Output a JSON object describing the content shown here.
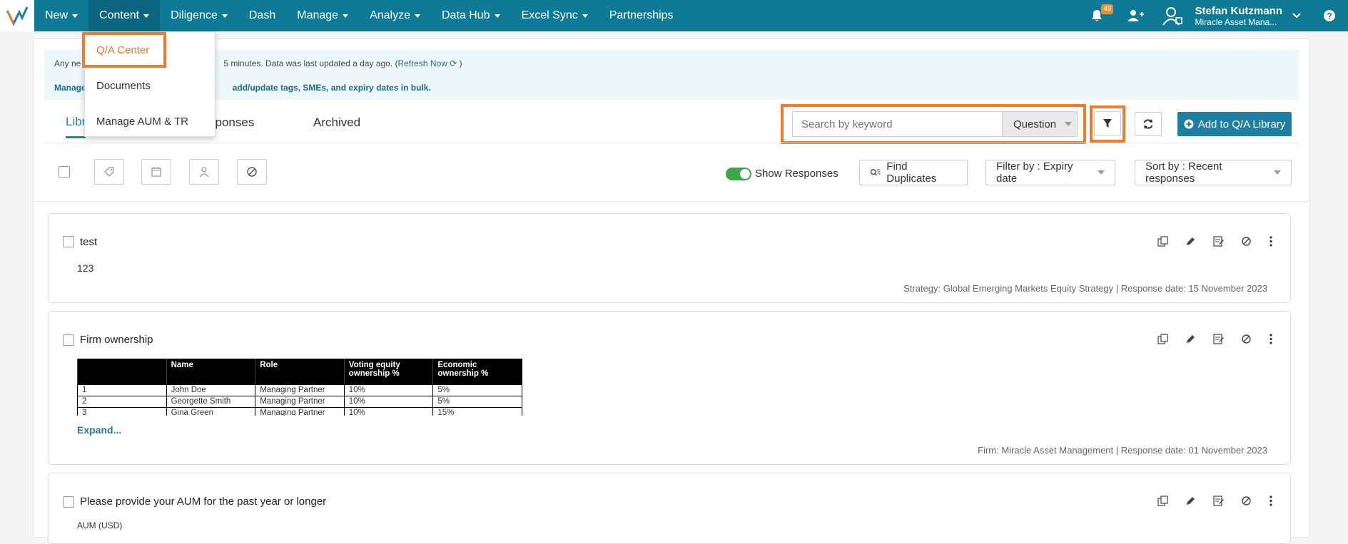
{
  "nav": {
    "items": [
      {
        "label": "New",
        "caret": true
      },
      {
        "label": "Content",
        "caret": true
      },
      {
        "label": "Diligence",
        "caret": true
      },
      {
        "label": "Dash",
        "caret": false
      },
      {
        "label": "Manage",
        "caret": true
      },
      {
        "label": "Analyze",
        "caret": true
      },
      {
        "label": "Data Hub",
        "caret": true
      },
      {
        "label": "Excel Sync",
        "caret": true
      },
      {
        "label": "Partnerships",
        "caret": false
      }
    ],
    "notification_count": "49",
    "user_name": "Stefan Kutzmann",
    "user_org": "Miracle Asset Mana..."
  },
  "content_menu": {
    "items": [
      "Q/A Center",
      "Documents",
      "Manage AUM & TR"
    ]
  },
  "info": {
    "line1_prefix": "Any ne",
    "line1_rest": "5 minutes. Data was last updated a day ago. (",
    "refresh": "Refresh Now",
    "line1_end": " )",
    "line2_prefix": "Manage",
    "line2_rest": "add/update tags, SMEs, and expiry dates in bulk."
  },
  "tabs": {
    "library": "Libr",
    "responses": "sponses",
    "archived": "Archived"
  },
  "search": {
    "placeholder": "Search by keyword",
    "scope": "Question"
  },
  "toolbar": {
    "add_label": "Add to Q/A Library",
    "show_responses": "Show Responses",
    "find_duplicates": "Find Duplicates",
    "filter_by": "Filter by : Expiry date",
    "sort_by": "Sort by : Recent responses"
  },
  "cards": [
    {
      "title": "test",
      "body": "123",
      "meta": "Strategy: Global Emerging Markets Equity Strategy | Response date: 15 November 2023"
    },
    {
      "title": "Firm ownership",
      "table": {
        "headers": [
          "",
          "Name",
          "Role",
          "Voting equity ownership %",
          "Economic ownership %"
        ],
        "rows": [
          [
            "1",
            "John Doe",
            "Managing Partner",
            "10%",
            "5%"
          ],
          [
            "2",
            "Georgette Smith",
            "Managing Partner",
            "10%",
            "5%"
          ],
          [
            "3",
            "Gina Green",
            "Managing Partner",
            "10%",
            "15%"
          ]
        ]
      },
      "expand": "Expand...",
      "meta": "Firm: Miracle Asset Management | Response date: 01 November 2023"
    },
    {
      "title": "Please provide your AUM for the past year or longer",
      "body": "AUM (USD)"
    }
  ]
}
